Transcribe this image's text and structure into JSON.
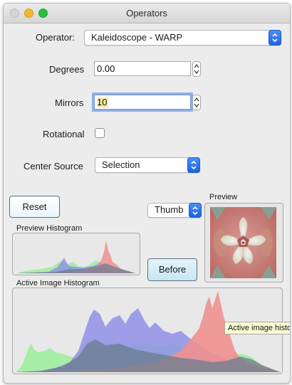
{
  "window": {
    "title": "Operators"
  },
  "operator": {
    "label": "Operator:",
    "value": "Kaleidoscope - WARP"
  },
  "degrees": {
    "label": "Degrees",
    "value": "0.00"
  },
  "mirrors": {
    "label": "Mirrors",
    "value": "10"
  },
  "rotational": {
    "label": "Rotational",
    "checked": false
  },
  "center_source": {
    "label": "Center Source",
    "value": "Selection"
  },
  "buttons": {
    "reset": "Reset",
    "before": "Before"
  },
  "thumb_select": {
    "value": "Thumb"
  },
  "preview": {
    "label": "Preview"
  },
  "preview_histogram": {
    "label": "Preview Histogram"
  },
  "active_histogram": {
    "label": "Active Image Histogram",
    "tooltip": "Active image histo"
  },
  "colors": {
    "accent": "#1c64e0",
    "hist_red": "#f09090",
    "hist_blue": "#8f8fe8",
    "hist_green": "#9aee9a",
    "hist_dark": "#6a7c8f"
  }
}
